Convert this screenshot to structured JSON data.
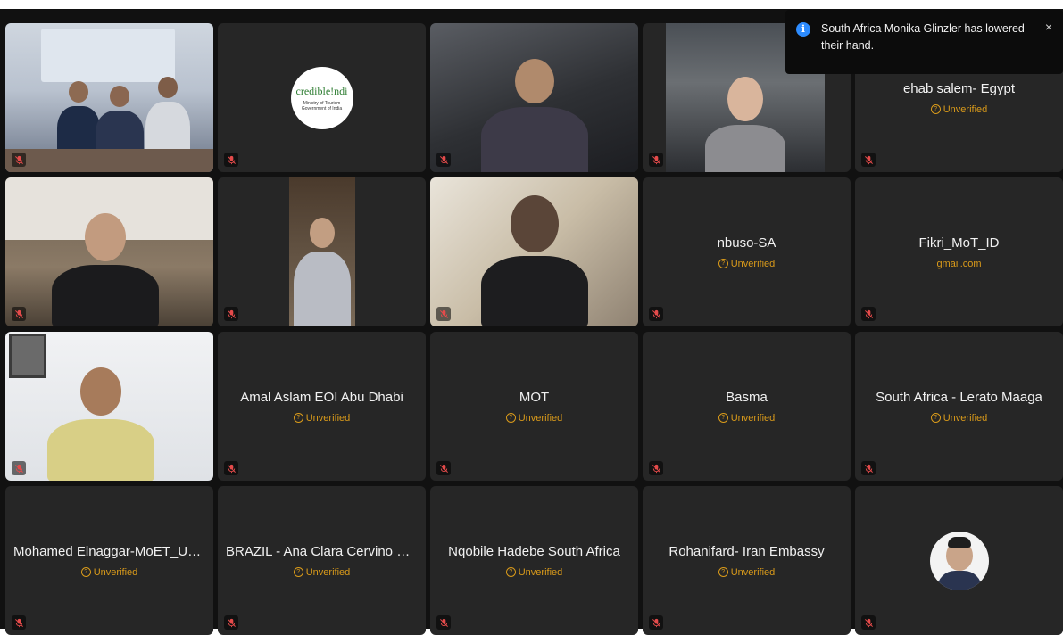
{
  "notification": {
    "text": "South Africa Monika Glinzler has lowered their hand.",
    "icon": "info-icon",
    "close_label": "×"
  },
  "status_label": "Unverified",
  "tiles": [
    {
      "id": "t1",
      "kind": "video",
      "scene": "room"
    },
    {
      "id": "t2",
      "kind": "logo",
      "logo_text": "credible!ndi",
      "logo_sub": "Ministry of Tourism Government of India"
    },
    {
      "id": "t3",
      "kind": "video",
      "scene": "dark"
    },
    {
      "id": "t4",
      "kind": "video",
      "scene": "window"
    },
    {
      "id": "t5",
      "kind": "name",
      "name": "ehab salem- Egypt",
      "status": "Unverified"
    },
    {
      "id": "t6",
      "kind": "video",
      "scene": "office"
    },
    {
      "id": "t7",
      "kind": "video",
      "scene": "dark"
    },
    {
      "id": "t8",
      "kind": "video",
      "scene": "bright"
    },
    {
      "id": "t9",
      "kind": "name",
      "name": "nbuso-SA",
      "status": "Unverified"
    },
    {
      "id": "t10",
      "kind": "name",
      "name": "Fikri_MoT_ID",
      "status_plain": "gmail.com"
    },
    {
      "id": "t11",
      "kind": "video",
      "scene": "yellow"
    },
    {
      "id": "t12",
      "kind": "name",
      "name": "Amal Aslam EOI Abu Dhabi",
      "status": "Unverified"
    },
    {
      "id": "t13",
      "kind": "name",
      "name": "MOT",
      "status": "Unverified"
    },
    {
      "id": "t14",
      "kind": "name",
      "name": "Basma",
      "status": "Unverified"
    },
    {
      "id": "t15",
      "kind": "name",
      "name": "South Africa - Lerato Maaga",
      "status": "Unverified"
    },
    {
      "id": "t16",
      "kind": "name",
      "name": "Mohamed Elnaggar-MoET_UAE",
      "status": "Unverified"
    },
    {
      "id": "t17",
      "kind": "name",
      "name": "BRAZIL - Ana Clara Cervino Bar...",
      "status": "Unverified"
    },
    {
      "id": "t18",
      "kind": "name",
      "name": "Nqobile Hadebe South Africa",
      "status": "Unverified"
    },
    {
      "id": "t19",
      "kind": "name",
      "name": "Rohanifard- Iran Embassy",
      "status": "Unverified"
    },
    {
      "id": "t20",
      "kind": "avatar"
    }
  ],
  "colors": {
    "tile_bg": "#262626",
    "status": "#d99a1a",
    "stage_bg": "#111111"
  }
}
